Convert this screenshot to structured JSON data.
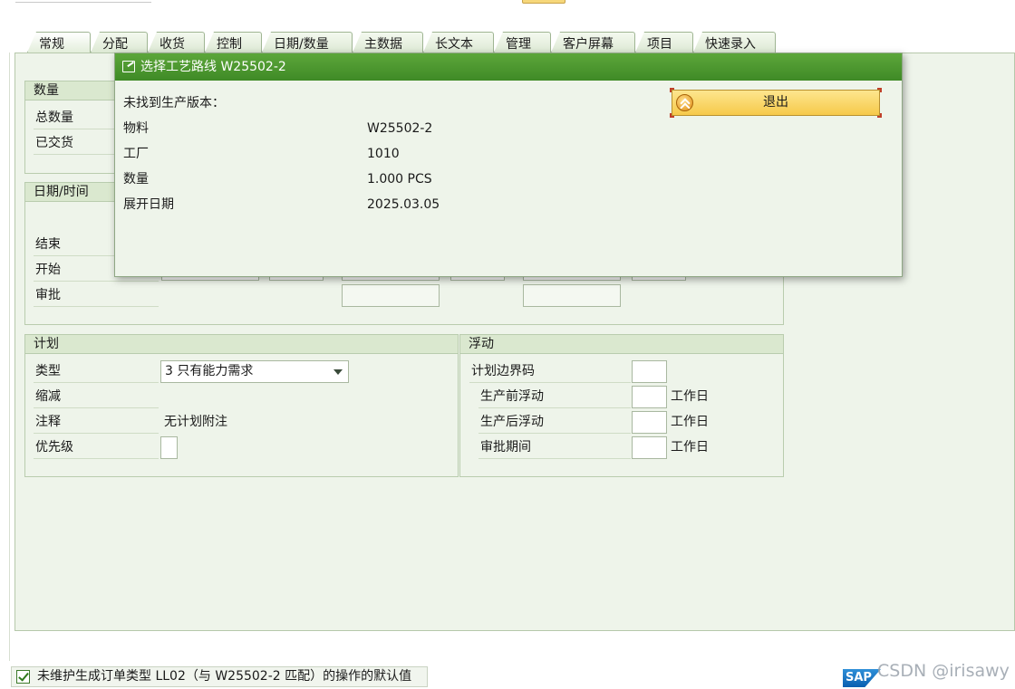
{
  "tabs": [
    "常规",
    "分配",
    "收货",
    "控制",
    "日期/数量",
    "主数据",
    "长文本",
    "管理",
    "客户屏幕",
    "项目",
    "快速录入"
  ],
  "quantity_group": {
    "title": "数量",
    "labels": [
      "总数量",
      "已交货"
    ]
  },
  "dates_group": {
    "title": "日期/时间",
    "labels": [
      "结束",
      "开始",
      "审批"
    ]
  },
  "plan_group": {
    "title": "计划",
    "type_label": "类型",
    "type_value": "3 只有能力需求",
    "reduction_label": "缩减",
    "note_label": "注释",
    "note_value": "无计划附注",
    "priority_label": "优先级"
  },
  "float_group": {
    "title": "浮动",
    "sched_margin_label": "计划边界码",
    "rows": [
      {
        "label": "生产前浮动",
        "unit": "工作日"
      },
      {
        "label": "生产后浮动",
        "unit": "工作日"
      },
      {
        "label": "审批期间",
        "unit": "工作日"
      }
    ]
  },
  "dialog": {
    "title": "选择工艺路线 W25502-2",
    "message": "未找到生产版本：",
    "rows": [
      {
        "label": "物料",
        "value": "W25502-2"
      },
      {
        "label": "工厂",
        "value": "1010"
      },
      {
        "label": "数量",
        "value": "1.000 PCS"
      },
      {
        "label": "展开日期",
        "value": "2025.03.05"
      }
    ],
    "exit_button": "退出"
  },
  "status_bar": {
    "message": "未维护生成订单类型 LL02（与 W25502-2 匹配）的操作的默认值"
  },
  "branding": {
    "logo_text": "SAP",
    "watermark": "CSDN @irisawy"
  }
}
